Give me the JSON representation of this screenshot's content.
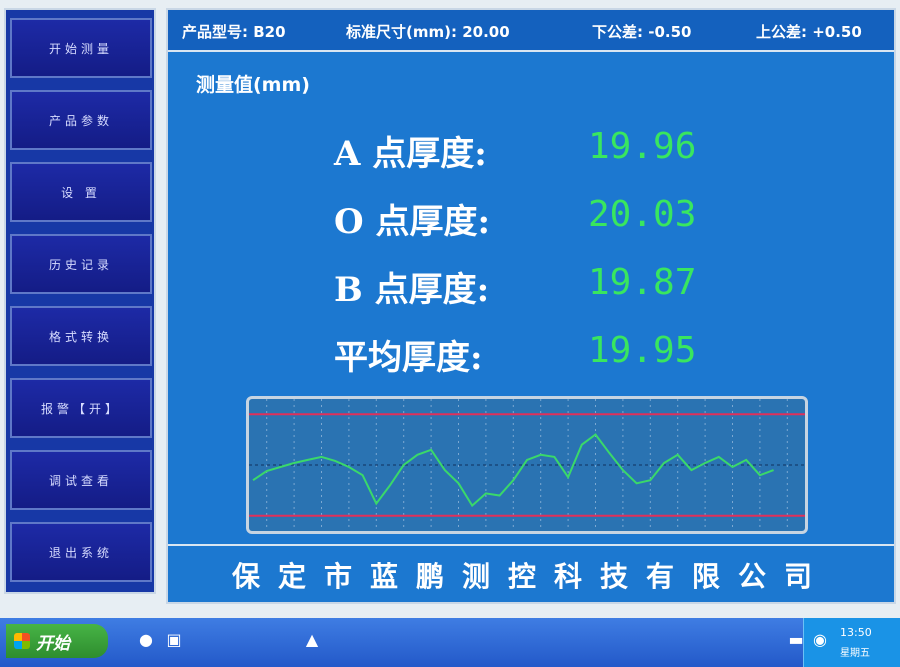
{
  "nav": {
    "items": [
      {
        "label": "开始测量"
      },
      {
        "label": "产品参数"
      },
      {
        "label": "设  置"
      },
      {
        "label": "历史记录"
      },
      {
        "label": "格式转换"
      },
      {
        "label": "报警【开】"
      },
      {
        "label": "调试查看"
      },
      {
        "label": "退出系统"
      }
    ]
  },
  "header": {
    "model": "产品型号: B20",
    "standard": "标准尺寸(mm): 20.00",
    "lower_tol": "下公差: -0.50",
    "upper_tol": "上公差: +0.50"
  },
  "measurements": {
    "unit_label": "测量值(mm)",
    "rows": [
      {
        "label": "A 点厚度:",
        "value": "19.96"
      },
      {
        "label": "O 点厚度:",
        "value": "20.03"
      },
      {
        "label": "B 点厚度:",
        "value": "19.87"
      },
      {
        "label": "平均厚度:",
        "value": "19.95"
      }
    ]
  },
  "chart_data": {
    "type": "line",
    "title": "",
    "xlabel": "",
    "ylabel": "",
    "limits": {
      "lower": 19.5,
      "upper": 20.5,
      "center": 20.0
    },
    "ylim": [
      19.35,
      20.65
    ],
    "x_points_capacity": 40,
    "series": [
      {
        "values": [
          19.85,
          19.94,
          19.98,
          20.02,
          20.05,
          20.08,
          20.04,
          19.98,
          19.9,
          19.62,
          19.8,
          20.0,
          20.1,
          20.15,
          19.95,
          19.82,
          19.6,
          19.72,
          19.7,
          19.85,
          20.05,
          20.1,
          20.08,
          19.88,
          20.2,
          20.3,
          20.12,
          19.95,
          19.82,
          19.85,
          20.02,
          20.1,
          19.95,
          20.02,
          20.08,
          19.98,
          20.05,
          19.9,
          19.95
        ]
      }
    ],
    "colors": {
      "line": "#3ad86a",
      "limit": "#e0305a",
      "center": "#10305e",
      "grid": "#9fbfe0"
    }
  },
  "footer": {
    "company": "保定市蓝鹏测控科技有限公司"
  },
  "taskbar": {
    "start_label": "开始",
    "icons": [
      "windows-logo-icon",
      "browser-icon",
      "media-icon",
      "app-icon",
      "keyboard-icon",
      "network-icon"
    ],
    "clock": "13:50",
    "tray_text": "星期五"
  },
  "colors": {
    "nav_bg": "#1738a6",
    "main_bg": "#1c78d0",
    "value_green": "#39e65f",
    "taskbar": "#2359c9"
  }
}
